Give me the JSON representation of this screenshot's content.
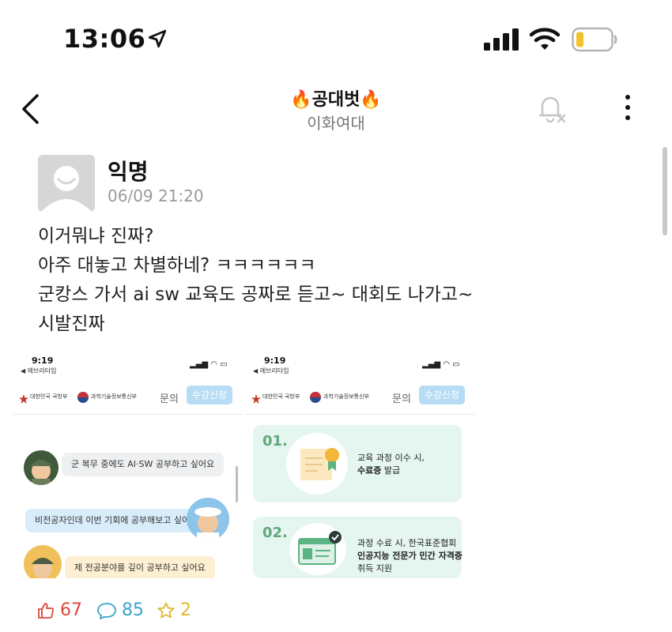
{
  "status_bar": {
    "time": "13:06"
  },
  "header": {
    "title": "🔥공대벗🔥",
    "subtitle": "이화여대"
  },
  "post": {
    "author": "익명",
    "time": "06/09 21:20",
    "lines": [
      "이거뭐냐 진짜?",
      "아주 대놓고 차별하네? ㅋㅋㅋㅋㅋㅋ",
      "군캉스 가서 ai sw 교육도 공짜로 듣고~ 대회도 나가고~",
      "시발진짜"
    ]
  },
  "shot_common": {
    "time": "9:19",
    "back_app": "◀ 에브리타임",
    "logo_mnd": "대한민국 국방부",
    "logo_msit": "과학기술정보통신부",
    "inquiry": "문의",
    "apply": "수강신청"
  },
  "shot1": {
    "bubbles": [
      "군 복무 중에도 AI·SW 공부하고 싶어요",
      "비전공자인데 이번 기회에 공부해보고 싶어요",
      "제 전공분야를 깊이 공부하고 싶어요"
    ]
  },
  "shot2": {
    "cards": [
      {
        "num": "01.",
        "line1": "교육 과정 이수 시,",
        "bold": "수료증",
        "rest": " 발급"
      },
      {
        "num": "02.",
        "line1": "과정 수료 시, 한국표준협회",
        "bold": "인공지능 전문가 민간 자격증",
        "line3": "취득 지원"
      }
    ]
  },
  "reactions": {
    "likes": "67",
    "comments": "85",
    "scraps": "2"
  },
  "colors": {
    "like": "#d94a3a",
    "comment": "#3ba4c9",
    "scrap": "#e0b72a",
    "apply": "#b7dcf5",
    "card": "#e5f5f0"
  }
}
